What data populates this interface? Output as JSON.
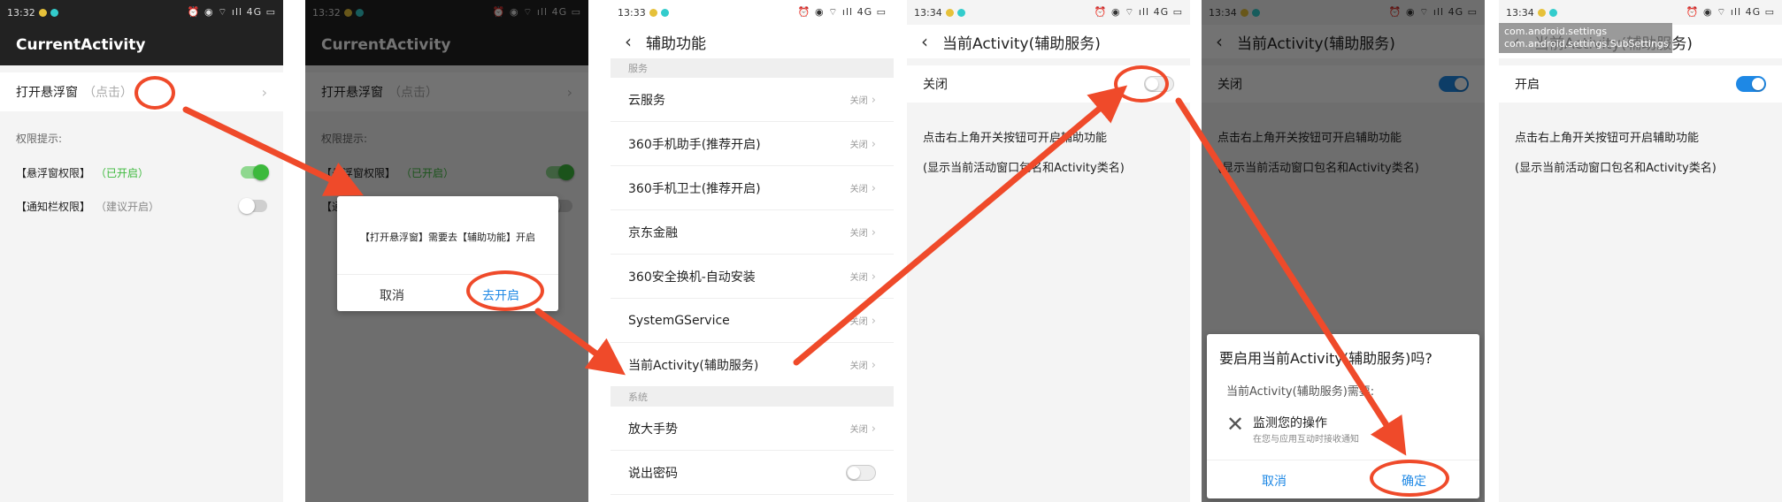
{
  "panel1": {
    "time": "13:32",
    "app_title": "CurrentActivity",
    "open_float_label": "打开悬浮窗",
    "open_float_hint": "（点击）",
    "perm_header": "权限提示:",
    "float_perm_label": "【悬浮窗权限】",
    "float_perm_status": "（已开启）",
    "notify_perm_label": "【通知栏权限】",
    "notify_perm_status": "（建议开启）"
  },
  "panel2": {
    "dialog_message": "【打开悬浮窗】需要去【辅助功能】开启",
    "cancel": "取消",
    "go_enable": "去开启"
  },
  "panel3": {
    "time": "13:33",
    "title": "辅助功能",
    "section_service": "服务",
    "section_system": "系统",
    "off_label": "关闭",
    "items": [
      {
        "label": "云服务"
      },
      {
        "label": "360手机助手(推荐开启)"
      },
      {
        "label": "360手机卫士(推荐开启)"
      },
      {
        "label": "京东金融"
      },
      {
        "label": "360安全换机-自动安装"
      },
      {
        "label": "SystemGService"
      },
      {
        "label": "当前Activity(辅助服务)"
      }
    ],
    "magnify": "放大手势",
    "speak_password": "说出密码"
  },
  "panel4": {
    "time": "13:34",
    "title": "当前Activity(辅助服务)",
    "state": "关闭",
    "desc1": "点击右上角开关按钮可开启辅助功能",
    "desc2": "(显示当前活动窗口包名和Activity类名)"
  },
  "panel5": {
    "dialog_title": "要启用当前Activity(辅助服务)吗?",
    "dialog_needs": "当前Activity(辅助服务)需要:",
    "monitor": "监测您的操作",
    "monitor_sub": "在您与应用互动时接收通知",
    "cancel": "取消",
    "ok": "确定"
  },
  "panel6": {
    "overlay_line1": "com.android.settings",
    "overlay_line2": "com.android.settings.SubSettings",
    "state": "开启"
  },
  "status_right": "⏰ ◉ ⌔ ıll 4G ▭",
  "colors": {
    "accent_red": "#ef4a2a",
    "blue": "#1e88e5",
    "green": "#3cb93c"
  }
}
